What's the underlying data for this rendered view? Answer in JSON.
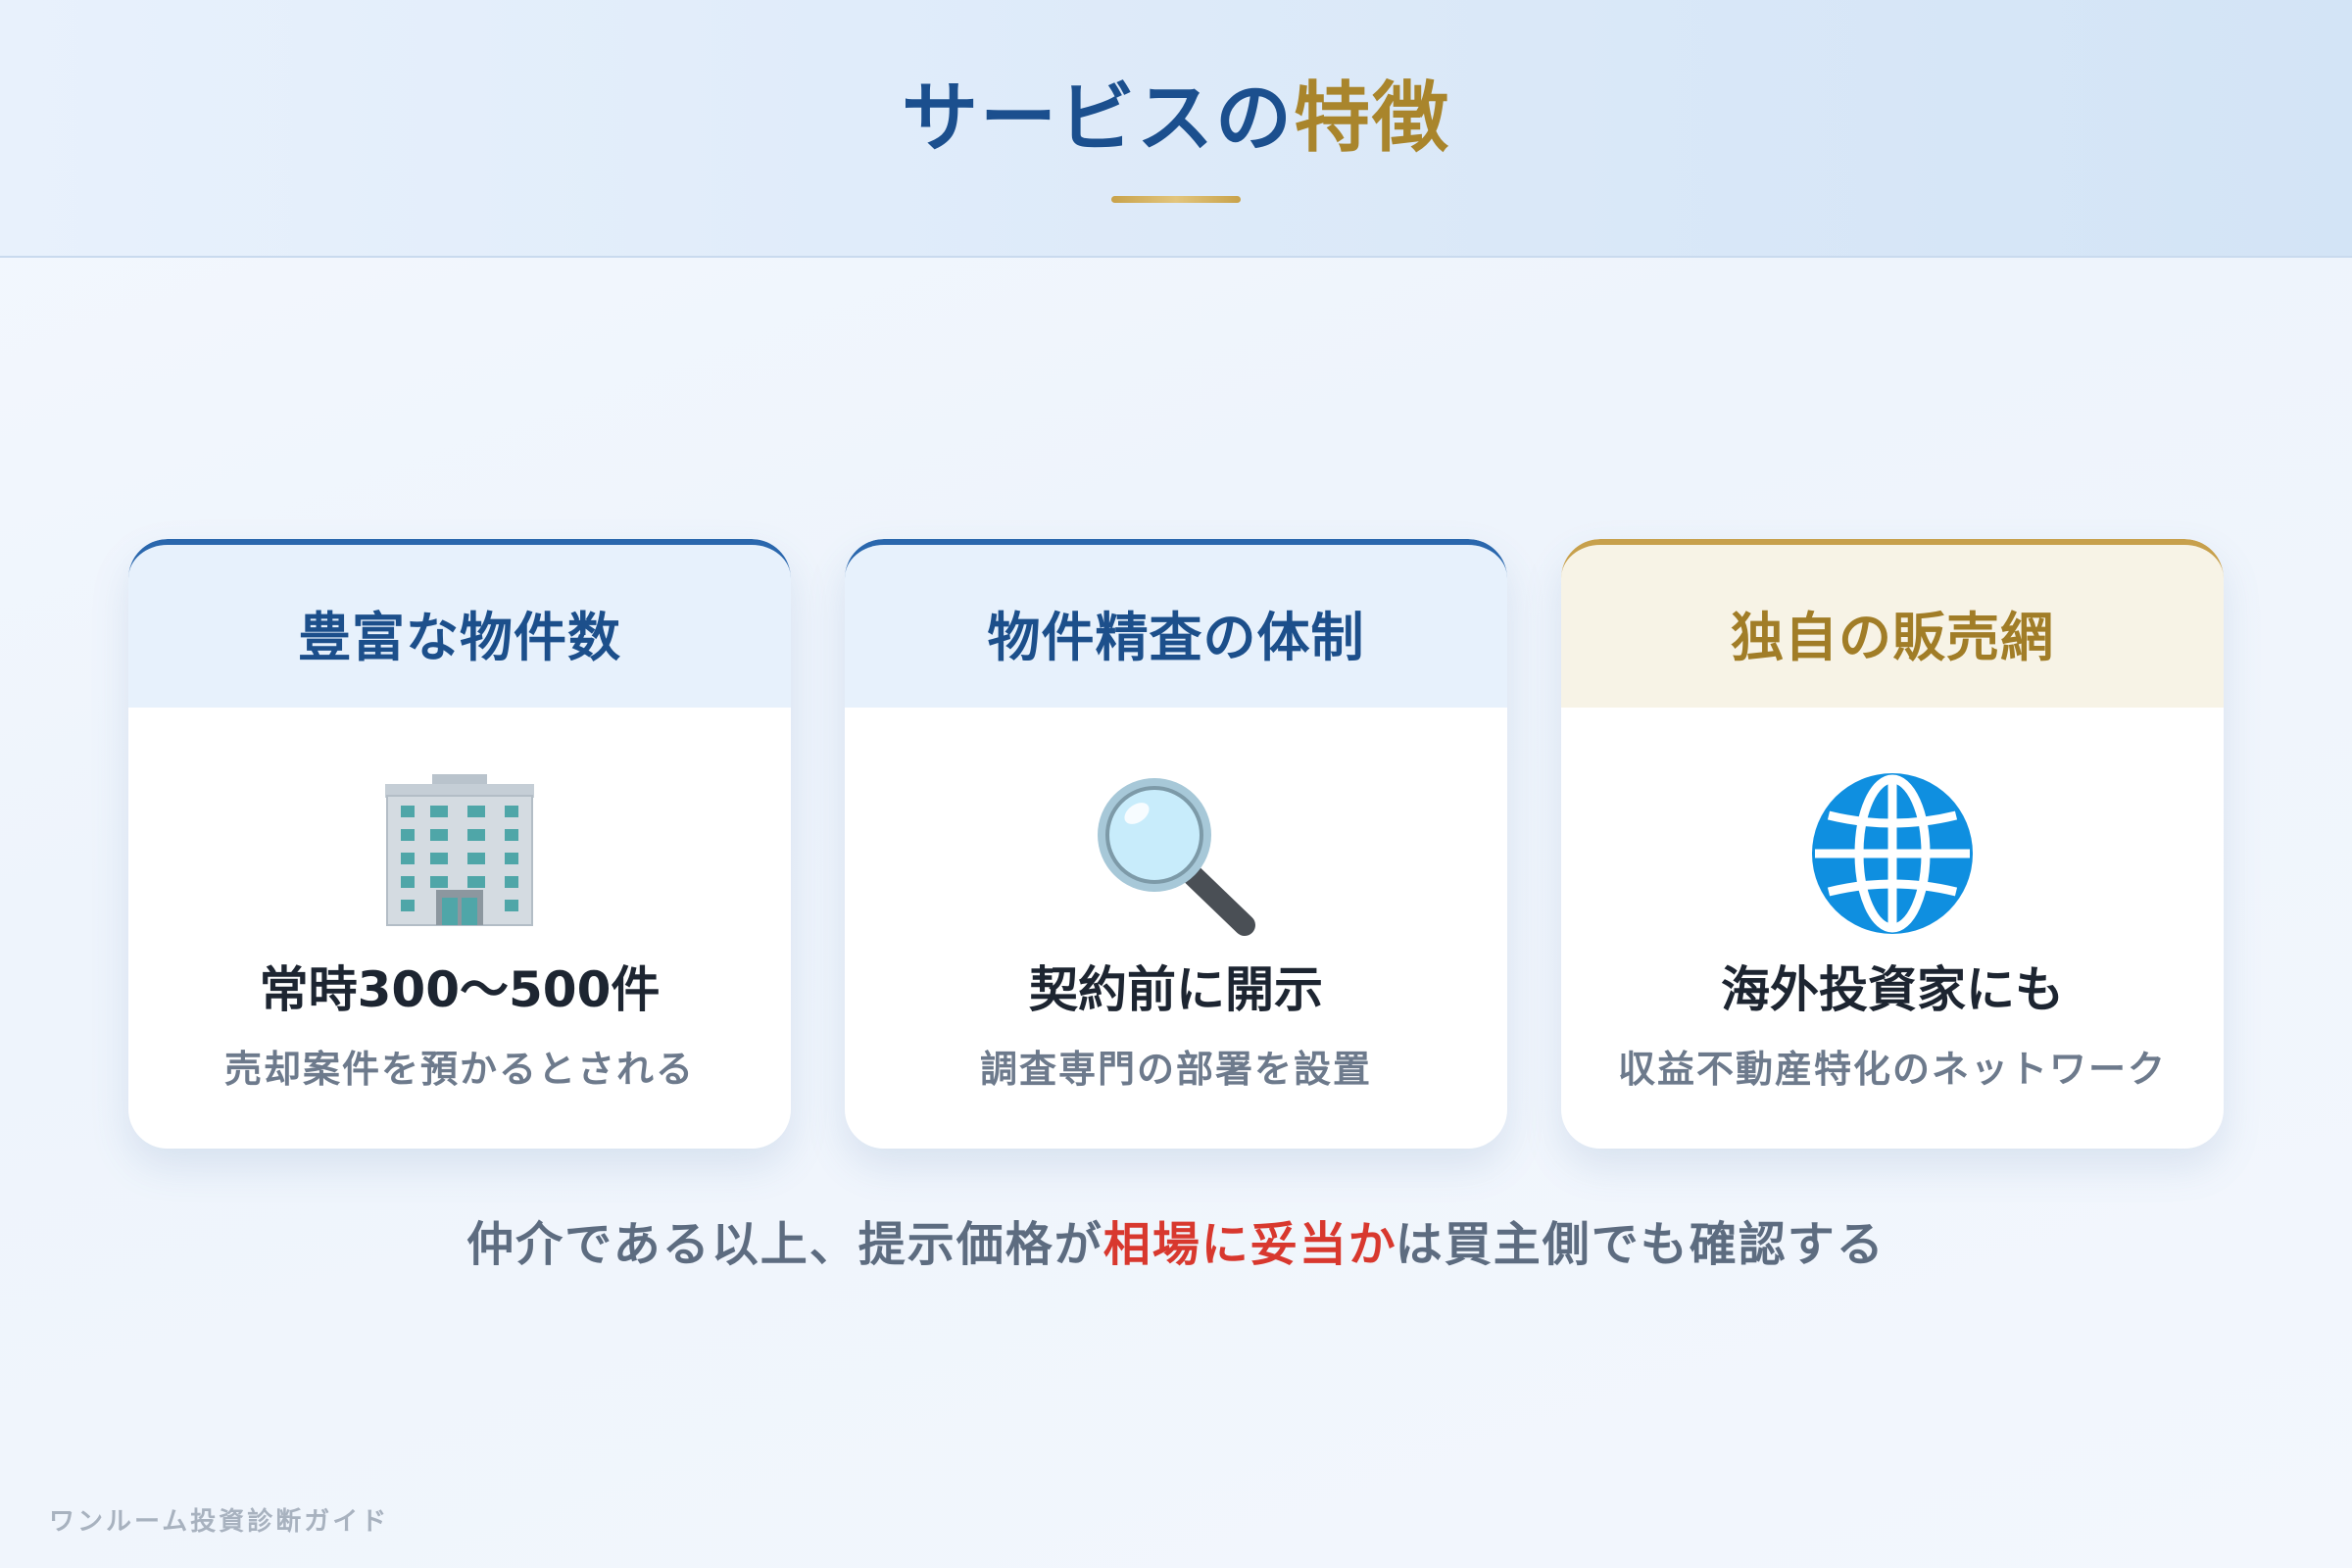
{
  "header": {
    "title_main": "サービスの",
    "title_accent": "特徴"
  },
  "cards": [
    {
      "title": "豊富な物件数",
      "icon": "office-building-icon",
      "main": "常時300〜500件",
      "sub": "売却案件を預かるとされる"
    },
    {
      "title": "物件精査の体制",
      "icon": "magnifying-glass-icon",
      "main": "契約前に開示",
      "sub": "調査専門の部署を設置"
    },
    {
      "title": "独自の販売網",
      "icon": "globe-icon",
      "main": "海外投資家にも",
      "sub": "収益不動産特化のネットワーク"
    }
  ],
  "note": {
    "before": "仲介である以上、提示価格が",
    "highlight": "相場に妥当か",
    "after": "は買主側でも確認する"
  },
  "footer": {
    "text": "ワンルーム投資診断ガイド"
  },
  "colors": {
    "primary_blue": "#1b4f8e",
    "accent_gold": "#a9852c",
    "highlight_red": "#d8382e"
  }
}
